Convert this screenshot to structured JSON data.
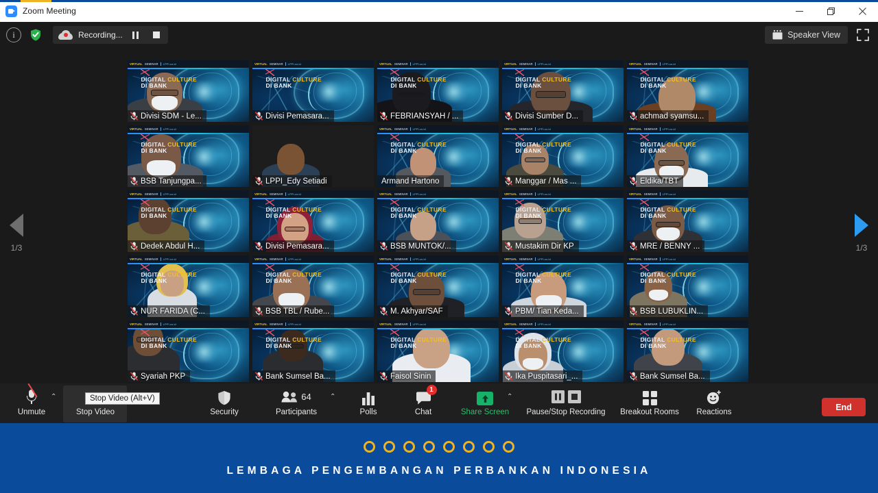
{
  "window": {
    "title": "Zoom Meeting",
    "logo_icon": "zoom-logo",
    "minimize_icon": "minimize-icon",
    "maximize_icon": "maximize-icon",
    "close_icon": "close-icon"
  },
  "topbar": {
    "info_icon": "info-icon",
    "info_label": "i",
    "encryption_icon": "shield-check-icon",
    "recording": {
      "icon": "recording-cloud-icon",
      "label": "Recording...",
      "pause_icon": "pause-icon",
      "stop_icon": "stop-icon"
    },
    "view_button": {
      "icon": "speaker-view-icon",
      "label": "Speaker View"
    },
    "fullscreen_icon": "fullscreen-icon"
  },
  "gallery": {
    "page_prev": {
      "icon": "chevron-left-arrow-icon",
      "label": "1/3",
      "enabled": false
    },
    "page_next": {
      "icon": "chevron-right-arrow-icon",
      "label": "1/3",
      "enabled": true
    },
    "virtual_background": {
      "strip_brand_yellow": "VIRTUAL",
      "strip_brand_white": "SEMINAR",
      "strip_brand_blue": "LPPI.co.id",
      "title_line1_a": "DIGITAL ",
      "title_line1_b": "CULTURE",
      "title_line2": "DI BANK"
    },
    "tiles": [
      {
        "name": "Divisi SDM - Le...",
        "muted": true,
        "active": false
      },
      {
        "name": "Divisi Pemasara...",
        "muted": true,
        "active": false
      },
      {
        "name": "FEBRIANSYAH / ...",
        "muted": true,
        "active": false
      },
      {
        "name": "Divisi Sumber D...",
        "muted": true,
        "active": false
      },
      {
        "name": "achmad syamsu...",
        "muted": true,
        "active": false
      },
      {
        "name": "BSB Tanjungpa...",
        "muted": true,
        "active": false
      },
      {
        "name": "LPPI_Edy Setiadi",
        "muted": true,
        "active": false
      },
      {
        "name": "Armand Hartono",
        "muted": false,
        "active": true
      },
      {
        "name": "Manggar / Mas ...",
        "muted": true,
        "active": false
      },
      {
        "name": "Eldika/TBT",
        "muted": true,
        "active": false
      },
      {
        "name": "Dedek Abdul H...",
        "muted": true,
        "active": false
      },
      {
        "name": "Divisi Pemasara...",
        "muted": true,
        "active": false
      },
      {
        "name": "BSB MUNTOK/...",
        "muted": true,
        "active": false
      },
      {
        "name": "Mustakim Dir KP",
        "muted": true,
        "active": false
      },
      {
        "name": "MRE / BENNY ...",
        "muted": true,
        "active": false
      },
      {
        "name": "NUR FARIDA (C...",
        "muted": true,
        "active": false
      },
      {
        "name": "BSB TBL / Rube...",
        "muted": true,
        "active": false
      },
      {
        "name": "M. Akhyar/SAF",
        "muted": true,
        "active": false
      },
      {
        "name": "PBM/ Tian Keda...",
        "muted": true,
        "active": false
      },
      {
        "name": "BSB LUBUKLIN...",
        "muted": true,
        "active": false
      },
      {
        "name": "Syariah PKP",
        "muted": true,
        "active": false
      },
      {
        "name": "Bank Sumsel Ba...",
        "muted": true,
        "active": false
      },
      {
        "name": "Faisol Sinin",
        "muted": true,
        "active": false
      },
      {
        "name": "Ika Puspitasari_...",
        "muted": true,
        "active": false
      },
      {
        "name": "Bank Sumsel Ba...",
        "muted": true,
        "active": false
      }
    ]
  },
  "toolbar": {
    "audio": {
      "icon": "microphone-muted-icon",
      "label": "Unmute",
      "caret": "⌃"
    },
    "video": {
      "icon": "video-camera-icon",
      "label": "Stop Video",
      "tooltip": "Stop Video (Alt+V)"
    },
    "security": {
      "icon": "shield-icon",
      "label": "Security"
    },
    "participants": {
      "icon": "participants-icon",
      "label": "Participants",
      "count": "64",
      "caret": "⌃"
    },
    "polls": {
      "icon": "polls-bar-chart-icon",
      "label": "Polls"
    },
    "chat": {
      "icon": "chat-bubble-icon",
      "label": "Chat",
      "badge": "1"
    },
    "share_screen": {
      "icon": "share-screen-up-arrow-icon",
      "label": "Share Screen",
      "caret": "⌃"
    },
    "recording_ctl": {
      "icon": "pause-stop-recording-icon",
      "label": "Pause/Stop Recording"
    },
    "breakout": {
      "icon": "breakout-rooms-grid-icon",
      "label": "Breakout Rooms"
    },
    "reactions": {
      "icon": "reactions-smiley-icon",
      "label": "Reactions"
    },
    "end": {
      "label": "End"
    }
  },
  "banner": {
    "dots_count": 8,
    "dot_color": "#f0b323",
    "background_color": "#0b4b9c",
    "text": "LEMBAGA PENGEMBANGAN PERBANKAN INDONESIA"
  }
}
